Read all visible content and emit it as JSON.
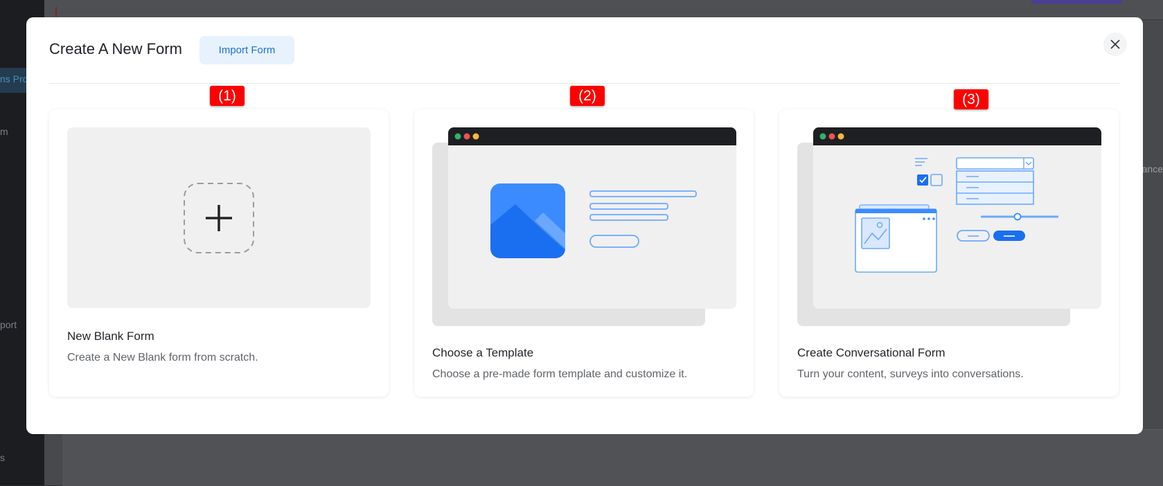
{
  "background": {
    "side_labels": [
      "ns Pro",
      "m",
      "port",
      "s"
    ],
    "right_label": "ance"
  },
  "modal": {
    "title": "Create A New Form",
    "import_button": "Import Form",
    "close_icon": "close-icon"
  },
  "cards": [
    {
      "title": "New Blank Form",
      "description": "Create a New Blank form from scratch.",
      "badge": "(1)",
      "icon": "plus-icon"
    },
    {
      "title": "Choose a Template",
      "description": "Choose a pre-made form template and customize it.",
      "badge": "(2)",
      "icon": "template-illustration"
    },
    {
      "title": "Create Conversational Form",
      "description": "Turn your content, surveys into conversations.",
      "badge": "(3)",
      "icon": "conversational-illustration"
    }
  ],
  "colors": {
    "accent": "#1a73d9",
    "illustration_blue": "#3b8bff",
    "badge_red": "#ff0000",
    "window_bar": "#1e1f22"
  }
}
